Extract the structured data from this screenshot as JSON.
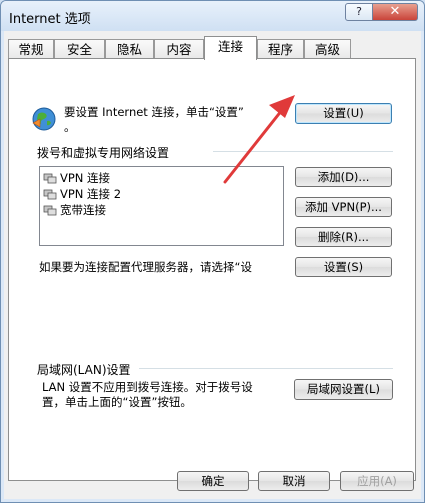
{
  "window": {
    "title": "Internet 选项",
    "help_label": "?",
    "close_label": "✕"
  },
  "tabs": [
    {
      "label": "常规"
    },
    {
      "label": "安全"
    },
    {
      "label": "隐私"
    },
    {
      "label": "内容"
    },
    {
      "label": "连接"
    },
    {
      "label": "程序"
    },
    {
      "label": "高级"
    }
  ],
  "active_tab": "连接",
  "setup": {
    "text_line1": "要设置 Internet 连接，单击“设置”",
    "text_line2": "。",
    "button_label": "设置(U)",
    "icon": "globe-icon"
  },
  "dialup": {
    "group_label": "拨号和虚拟专用网络设置",
    "connections": [
      {
        "label": "VPN 连接"
      },
      {
        "label": "VPN 连接 2"
      },
      {
        "label": "宽带连接"
      }
    ],
    "add_button": "添加(D)...",
    "add_vpn_button": "添加 VPN(P)...",
    "remove_button": "删除(R)...",
    "settings_button": "设置(S)",
    "proxy_text": "如果要为连接配置代理服务器，请选择“设"
  },
  "lan": {
    "group_label": "局域网(LAN)设置",
    "text_line1": "LAN 设置不应用到拨号连接。对于拨号设",
    "text_line2": "置，单击上面的“设置”按钮。",
    "button_label": "局域网设置(L)"
  },
  "footer": {
    "ok_label": "确定",
    "cancel_label": "取消",
    "apply_label": "应用(A)"
  },
  "colors": {
    "annotation_arrow": "#e03a3a",
    "focus_border": "#3c7fb1"
  }
}
